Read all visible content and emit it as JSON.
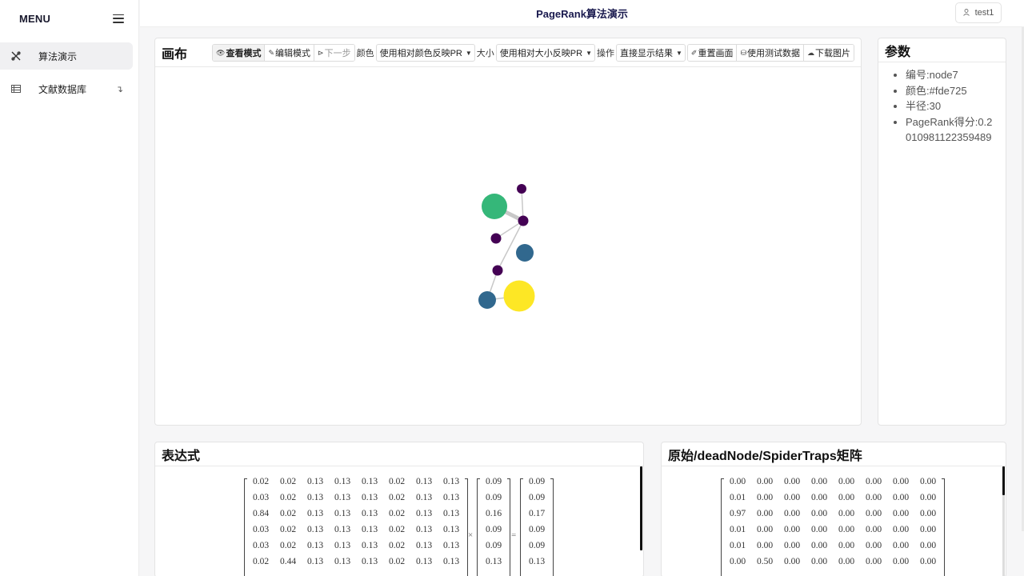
{
  "sidebar": {
    "title": "MENU",
    "items": [
      {
        "label": "算法演示",
        "active": true
      },
      {
        "label": "文献数据库",
        "arrow": "↴"
      }
    ]
  },
  "header": {
    "title": "PageRank算法演示",
    "user": "test1"
  },
  "canvas": {
    "title": "画布",
    "toolbar": {
      "view_mode": "查看模式",
      "edit_mode": "编辑模式",
      "next_step": "下一步",
      "color_label": "颜色",
      "color_select": "使用相对颜色反映PR",
      "size_label": "大小",
      "size_select": "使用相对大小反映PR",
      "op_label": "操作",
      "op_select": "直接显示结果",
      "reset": "重置画面",
      "test_data": "使用测试数据",
      "download": "下载图片"
    },
    "graph": {
      "nodes": [
        {
          "id": "a",
          "color": "#440154"
        },
        {
          "id": "b",
          "color": "#35b779"
        },
        {
          "id": "c",
          "color": "#440154"
        },
        {
          "id": "d",
          "color": "#440154"
        },
        {
          "id": "e",
          "color": "#31688e"
        },
        {
          "id": "f",
          "color": "#440154"
        },
        {
          "id": "g",
          "color": "#31688e"
        },
        {
          "id": "h",
          "color": "#fde725"
        }
      ],
      "edge_color": "#c8c8c8"
    }
  },
  "params": {
    "title": "参数",
    "items": [
      "编号:node7",
      "颜色:#fde725",
      "半径:30",
      "PageRank得分:0.2010981122359489"
    ]
  },
  "expression": {
    "title": "表达式",
    "matrix": [
      [
        "0.02",
        "0.02",
        "0.13",
        "0.13",
        "0.13",
        "0.02",
        "0.13",
        "0.13"
      ],
      [
        "0.03",
        "0.02",
        "0.13",
        "0.13",
        "0.13",
        "0.02",
        "0.13",
        "0.13"
      ],
      [
        "0.84",
        "0.02",
        "0.13",
        "0.13",
        "0.13",
        "0.02",
        "0.13",
        "0.13"
      ],
      [
        "0.03",
        "0.02",
        "0.13",
        "0.13",
        "0.13",
        "0.02",
        "0.13",
        "0.13"
      ],
      [
        "0.03",
        "0.02",
        "0.13",
        "0.13",
        "0.13",
        "0.02",
        "0.13",
        "0.13"
      ],
      [
        "0.02",
        "0.44",
        "0.13",
        "0.13",
        "0.13",
        "0.02",
        "0.13",
        "0.13"
      ]
    ],
    "vector_in": [
      "0.09",
      "0.09",
      "0.16",
      "0.09",
      "0.09",
      "0.13"
    ],
    "vector_out": [
      "0.09",
      "0.09",
      "0.17",
      "0.09",
      "0.09",
      "0.13"
    ],
    "times": "×",
    "equals": "="
  },
  "spider_matrix": {
    "title": "原始/deadNode/SpiderTraps矩阵",
    "matrix": [
      [
        "0.00",
        "0.00",
        "0.00",
        "0.00",
        "0.00",
        "0.00",
        "0.00",
        "0.00"
      ],
      [
        "0.01",
        "0.00",
        "0.00",
        "0.00",
        "0.00",
        "0.00",
        "0.00",
        "0.00"
      ],
      [
        "0.97",
        "0.00",
        "0.00",
        "0.00",
        "0.00",
        "0.00",
        "0.00",
        "0.00"
      ],
      [
        "0.01",
        "0.00",
        "0.00",
        "0.00",
        "0.00",
        "0.00",
        "0.00",
        "0.00"
      ],
      [
        "0.01",
        "0.00",
        "0.00",
        "0.00",
        "0.00",
        "0.00",
        "0.00",
        "0.00"
      ],
      [
        "0.00",
        "0.50",
        "0.00",
        "0.00",
        "0.00",
        "0.00",
        "0.00",
        "0.00"
      ]
    ]
  }
}
